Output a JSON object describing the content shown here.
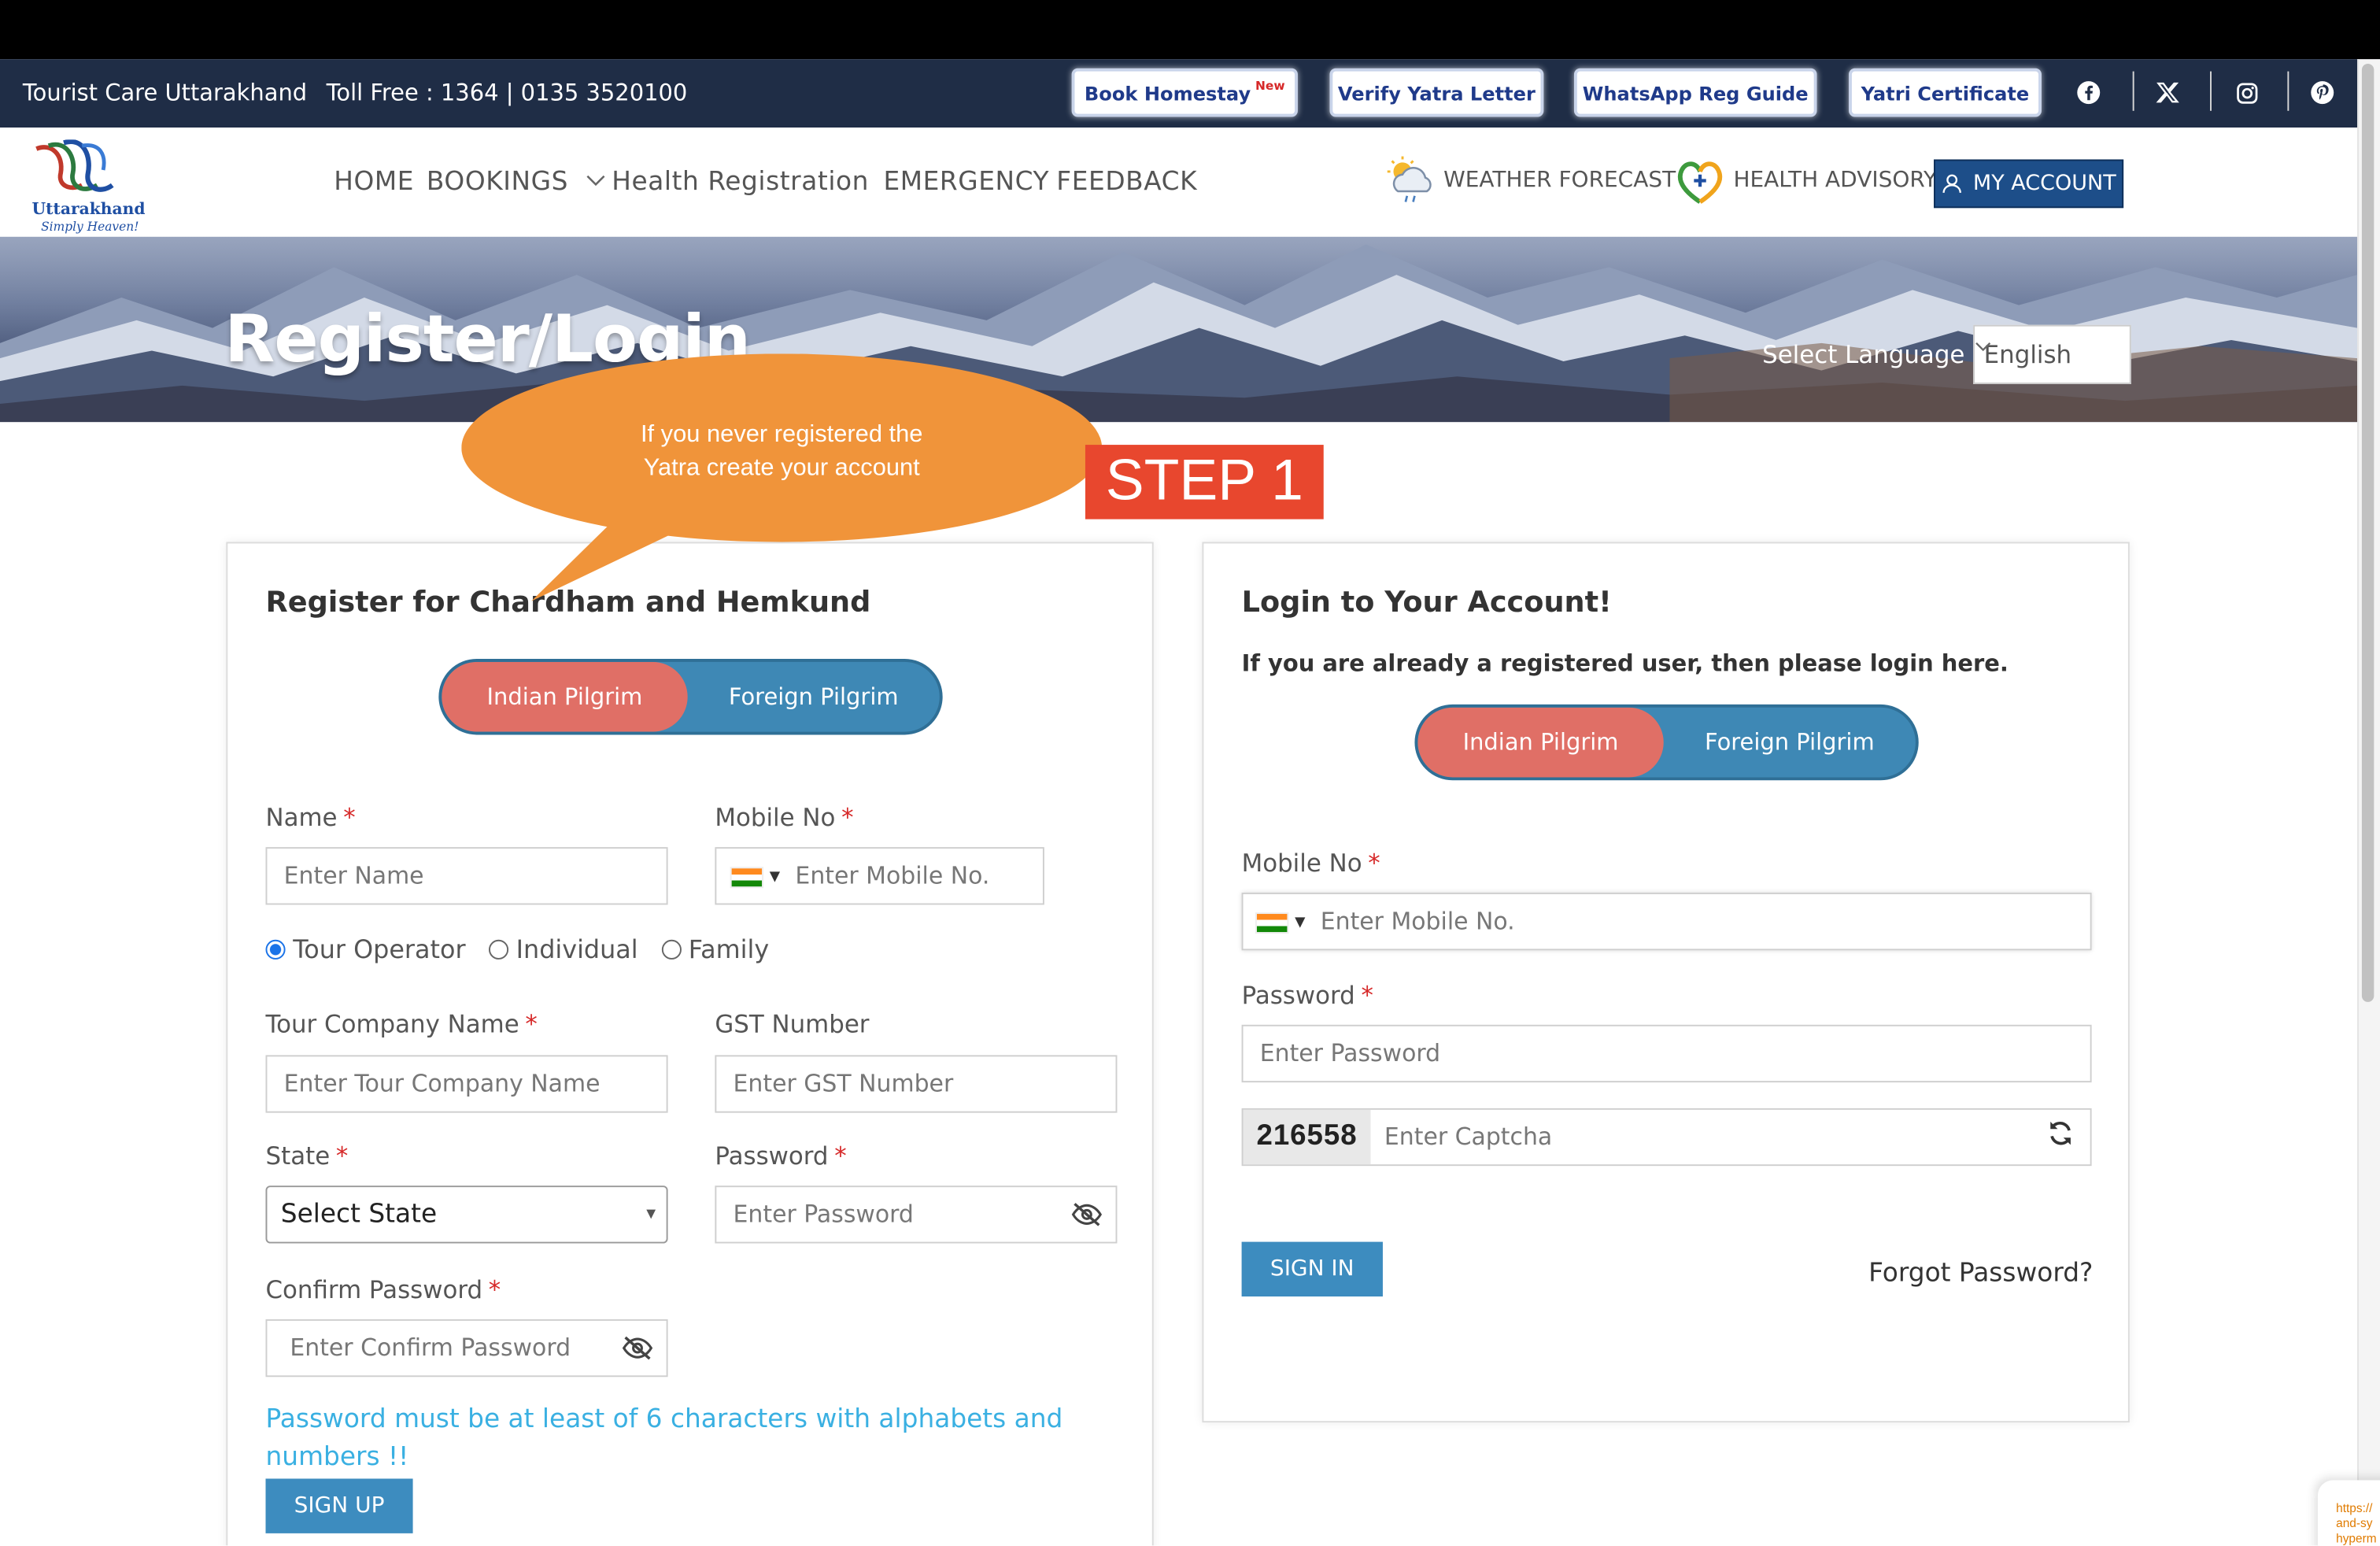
{
  "topbar": {
    "site_name": "Tourist Care Uttarakhand",
    "toll_free": "Toll Free : 1364 | 0135 3520100",
    "buttons": [
      {
        "label": "Book Homestay",
        "badge": "New"
      },
      {
        "label": "Verify Yatra Letter"
      },
      {
        "label": "WhatsApp Reg Guide"
      },
      {
        "label": "Yatri Certificate"
      }
    ],
    "social_icons": [
      "facebook-icon",
      "x-icon",
      "instagram-icon",
      "pinterest-icon"
    ]
  },
  "logo": {
    "name": "Uttarakhand",
    "tagline": "Simply Heaven!"
  },
  "nav": {
    "items": [
      "HOME",
      "BOOKINGS",
      "Health Registration",
      "EMERGENCY",
      "FEEDBACK"
    ],
    "weather": "WEATHER FORECAST",
    "health": "HEALTH ADVISORY",
    "account": "MY ACCOUNT"
  },
  "hero": {
    "title": "Register/Login",
    "language_label": "Select Language",
    "language_value": "English"
  },
  "annotation": {
    "callout_line1": "If you never registered the",
    "callout_line2": "Yatra create your account",
    "step": "STEP 1",
    "callout_color": "#f0943a",
    "step_color": "#e8472e"
  },
  "register": {
    "title": "Register for Chardham and Hemkund",
    "toggle_on": "Indian Pilgrim",
    "toggle_off": "Foreign Pilgrim",
    "name_label": "Name",
    "name_placeholder": "Enter Name",
    "mobile_label": "Mobile No",
    "mobile_placeholder": "Enter  Mobile No.",
    "radios": [
      {
        "label": "Tour Operator",
        "selected": true
      },
      {
        "label": "Individual",
        "selected": false
      },
      {
        "label": "Family",
        "selected": false
      }
    ],
    "company_label": "Tour Company Name",
    "company_placeholder": "Enter Tour Company Name",
    "gst_label": "GST Number",
    "gst_placeholder": "Enter GST Number",
    "state_label": "State",
    "state_value": "Select State",
    "password_label": "Password",
    "password_placeholder": "Enter  Password",
    "confirm_label": "Confirm Password",
    "confirm_placeholder": "Enter Confirm Password",
    "hint": "Password must be at least of 6 characters with alphabets and numbers !!",
    "signup": "SIGN UP"
  },
  "login": {
    "title": "Login to Your Account!",
    "subtitle": "If you are already a registered user, then please login here.",
    "toggle_on": "Indian Pilgrim",
    "toggle_off": "Foreign Pilgrim",
    "mobile_label": "Mobile No",
    "mobile_placeholder": "Enter  Mobile No.",
    "password_label": "Password",
    "password_placeholder": "Enter  Password",
    "captcha_code": "216558",
    "captcha_placeholder": "Enter Captcha",
    "signin": "SIGN IN",
    "forgot": "Forgot Password?"
  },
  "colors": {
    "topbar_bg": "#1f2d46",
    "account_btn": "#1d4e89",
    "toggle_active": "#e06f66",
    "toggle_bg": "#3e88b5",
    "primary_btn": "#3d8cbf",
    "hint": "#3ab0e2"
  }
}
